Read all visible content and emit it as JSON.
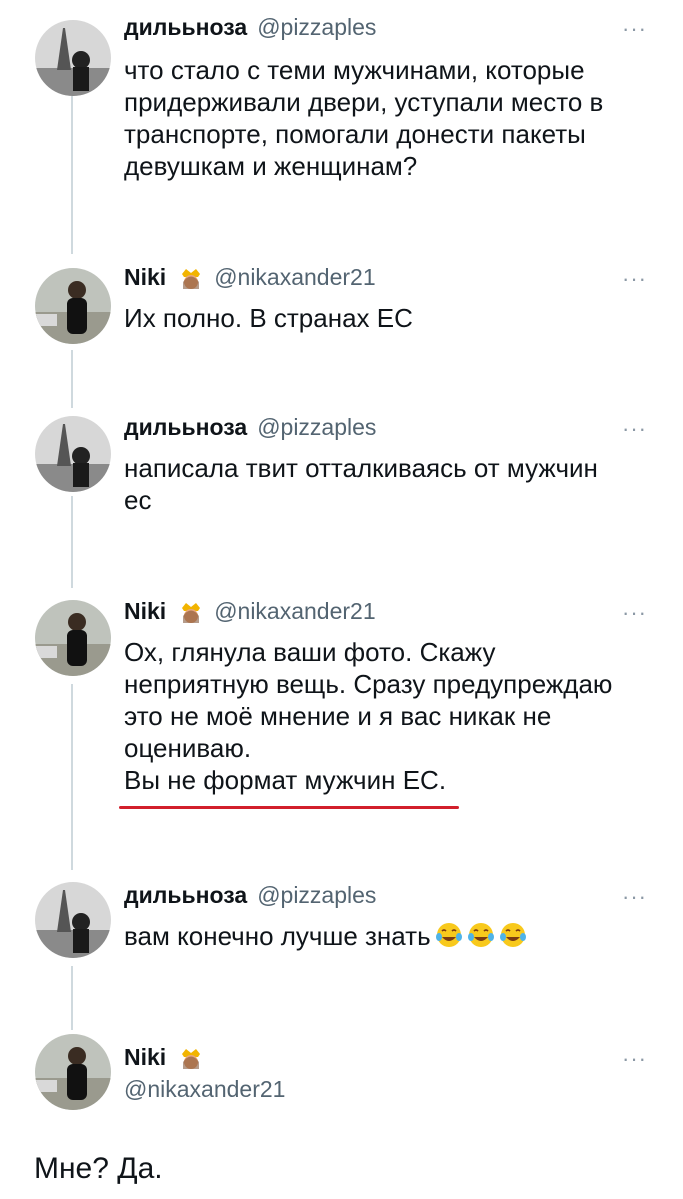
{
  "thread": [
    {
      "author": "дилььноза",
      "handle": "@pizzaples",
      "lines": [
        "что стало с теми мужчинами, которые",
        "придерживали двери, уступали место в",
        "транспорте, помогали донести пакеты",
        "девушкам и женщинам?"
      ]
    },
    {
      "author": "Niki",
      "handle": "@nikaxander21",
      "lines": [
        "Их полно. В странах ЕС"
      ]
    },
    {
      "author": "дилььноза",
      "handle": "@pizzaples",
      "lines": [
        "написала твит отталкиваясь от мужчин",
        "ес"
      ]
    },
    {
      "author": "Niki",
      "handle": "@nikaxander21",
      "lines": [
        "Ох, глянула ваши фото. Скажу",
        "неприятную вещь. Сразу предупреждаю",
        "это не моё мнение и я вас никак не",
        "оцениваю.",
        "Вы не формат мужчин ЕС."
      ]
    },
    {
      "author": "дилььноза",
      "handle": "@pizzaples",
      "lines": [
        "вам конечно лучше знать"
      ],
      "emoji": [
        "face-with-tears-of-joy",
        "face-with-tears-of-joy",
        "face-with-tears-of-joy"
      ]
    },
    {
      "author": "Niki",
      "handle": "@nikaxander21"
    }
  ],
  "more_icon": "···",
  "crown_icon": "princess-emoji",
  "final_reply": "Мне? Да.",
  "colors": {
    "thread_line": "#cfd9de",
    "handle": "#536471",
    "underline": "#d21f2b"
  }
}
